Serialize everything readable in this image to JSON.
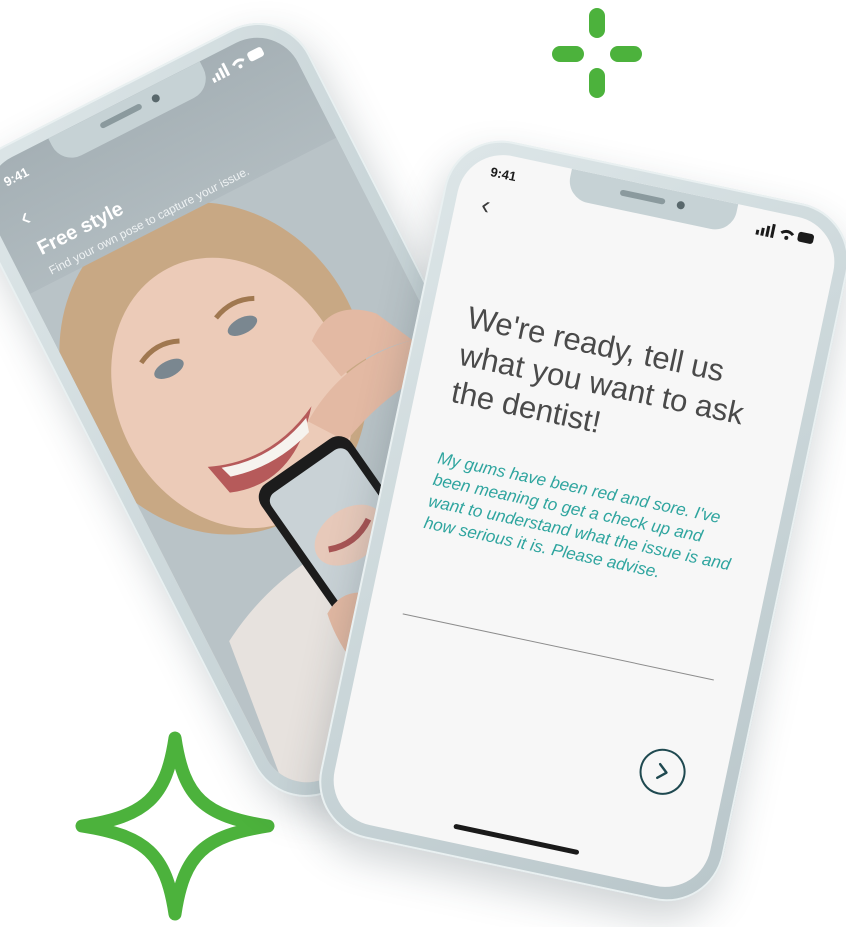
{
  "colors": {
    "accent_green": "#4cb23c",
    "message_teal": "#2fa59f",
    "heading_gray": "#4a4a4a",
    "button_navy": "#1f4950"
  },
  "left_phone": {
    "status_time": "9:41",
    "title": "Free style",
    "subtitle": "Find your own pose to capture your issue.",
    "back_icon": "chevron-left-icon"
  },
  "right_phone": {
    "status_time": "9:41",
    "back_icon": "chevron-left-icon",
    "heading": "We're ready, tell us what you want to ask the dentist!",
    "message": "My gums have been red and sore. I've been meaning to get a check up and want to understand what the issue is and how serious it is. Please advise.",
    "next_icon": "chevron-right-icon"
  }
}
